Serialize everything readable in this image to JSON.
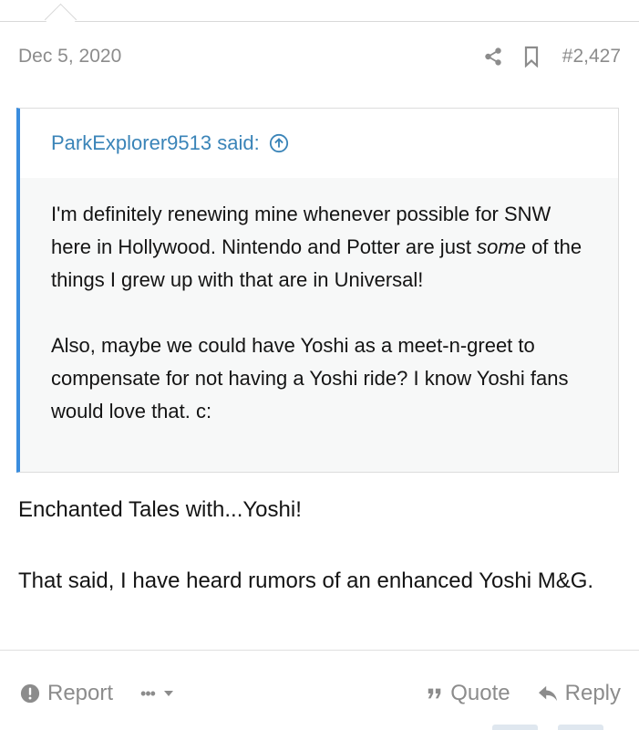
{
  "post": {
    "date": "Dec 5, 2020",
    "number": "#2,427",
    "icons": {
      "share": "share-icon",
      "bookmark": "bookmark-icon"
    }
  },
  "quote": {
    "author": "ParkExplorer9513 said:",
    "paragraph1_a": "I'm definitely renewing mine whenever possible for SNW here in Hollywood. Nintendo and Potter are just ",
    "paragraph1_em": "some",
    "paragraph1_b": " of the things I grew up with that are in Universal!",
    "paragraph2": "Also, maybe we could have Yoshi as a meet-n-greet to compensate for not having a Yoshi ride? I know Yoshi fans would love that. c:"
  },
  "reply": {
    "paragraph1": "Enchanted Tales with...Yoshi!",
    "paragraph2": "That said, I have heard rumors of an enhanced Yoshi M&G."
  },
  "actions": {
    "report": "Report",
    "more": "•••",
    "quote": "Quote",
    "reply": "Reply"
  },
  "colors": {
    "accent": "#3a8dde",
    "link": "#3a84b8",
    "muted": "#8c8c8c"
  }
}
